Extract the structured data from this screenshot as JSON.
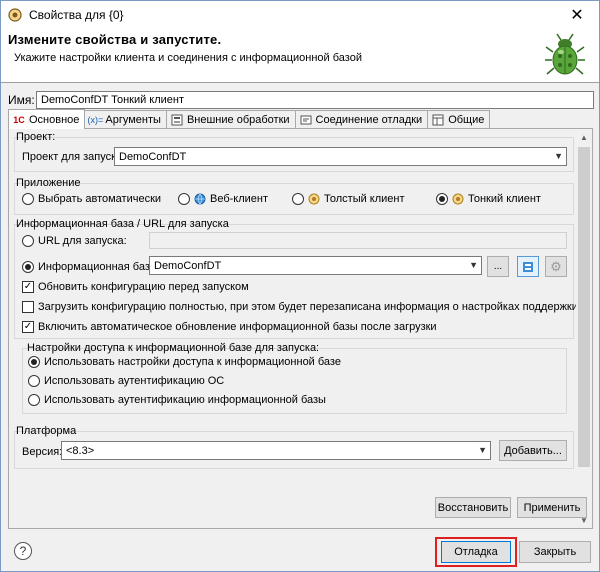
{
  "window": {
    "title": "Свойства для {0}"
  },
  "banner": {
    "heading": "Измените свойства и запустите.",
    "subheading": "Укажите настройки клиента и соединения с информационной базой"
  },
  "name": {
    "label": "Имя:",
    "value": "DemoConfDT Тонкий клиент"
  },
  "tabs": [
    {
      "label": "Основное",
      "icon": "1c-icon",
      "active": true
    },
    {
      "label": "Аргументы",
      "icon": "arguments-icon"
    },
    {
      "label": "Внешние обработки",
      "icon": "external-icon"
    },
    {
      "label": "Соединение отладки",
      "icon": "debug-connection-icon"
    },
    {
      "label": "Общие",
      "icon": "common-icon"
    }
  ],
  "project": {
    "group_label": "Проект:",
    "field_label": "Проект для запуска:",
    "value": "DemoConfDT"
  },
  "app": {
    "group_label": "Приложение",
    "options": [
      {
        "label": "Выбрать автоматически",
        "selected": false
      },
      {
        "label": "Веб-клиент",
        "selected": false
      },
      {
        "label": "Толстый клиент",
        "selected": false
      },
      {
        "label": "Тонкий клиент",
        "selected": true
      }
    ]
  },
  "infobase": {
    "group_label": "Информационная база / URL для запуска",
    "url_label": "URL для запуска:",
    "base_label": "Информационная база:",
    "base_value": "DemoConfDT",
    "browse_label": "...",
    "check_update": "Обновить конфигурацию перед запуском",
    "check_full": "Загрузить конфигурацию полностью, при этом будет перезаписана информация о настройках поддержки",
    "check_auto": "Включить автоматическое обновление информационной базы после загрузки"
  },
  "access": {
    "group_label": "Настройки доступа к информационной базе для запуска:",
    "options": [
      "Использовать настройки доступа к информационной базе",
      "Использовать аутентификацию ОС",
      "Использовать аутентификацию информационной базы"
    ]
  },
  "platform": {
    "group_label": "Платформа",
    "version_label": "Версия:",
    "version_value": "<8.3>",
    "add_label": "Добавить..."
  },
  "buttons": {
    "restore": "Восстановить",
    "apply": "Применить",
    "debug": "Отладка",
    "close": "Закрыть",
    "help": "?"
  },
  "colors": {
    "highlight": "#e02020",
    "bug_green": "#5aa63a"
  }
}
